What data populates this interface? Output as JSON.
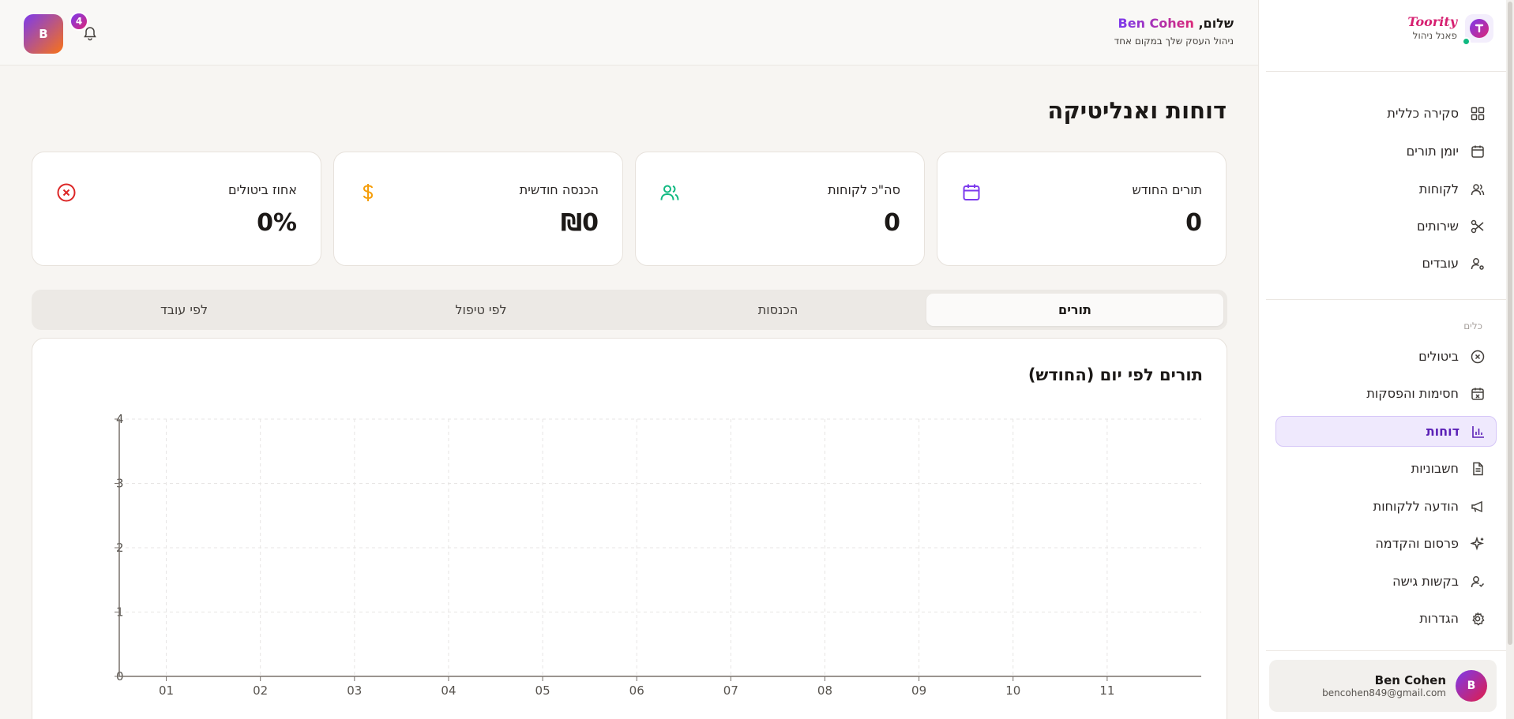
{
  "brand": {
    "name": "Toority",
    "subtitle": "פאנל ניהול"
  },
  "sidebar": {
    "main_items": [
      {
        "label": "סקירה כללית",
        "icon": "dashboard-grid-icon"
      },
      {
        "label": "יומן תורים",
        "icon": "calendar-icon"
      },
      {
        "label": "לקוחות",
        "icon": "users-icon"
      },
      {
        "label": "שירותים",
        "icon": "scissors-icon"
      },
      {
        "label": "עובדים",
        "icon": "user-cog-icon"
      }
    ],
    "tools_label": "כלים",
    "tool_items": [
      {
        "label": "ביטולים",
        "icon": "x-circle-icon"
      },
      {
        "label": "חסימות והפסקות",
        "icon": "calendar-x-icon"
      },
      {
        "label": "דוחות",
        "icon": "bar-chart-icon",
        "active": true
      },
      {
        "label": "חשבוניות",
        "icon": "file-text-icon"
      },
      {
        "label": "הודעה ללקוחות",
        "icon": "megaphone-icon"
      },
      {
        "label": "פרסום והקדמה",
        "icon": "sparkles-icon"
      },
      {
        "label": "בקשות גישה",
        "icon": "user-check-icon"
      },
      {
        "label": "הגדרות",
        "icon": "gear-icon"
      }
    ],
    "user": {
      "initial": "B",
      "name": "Ben Cohen",
      "email": "bencohen849@gmail.com"
    }
  },
  "header": {
    "greeting_prefix": "שלום,",
    "greeting_name": "Ben Cohen",
    "subtitle": "ניהול העסק שלך במקום אחד",
    "avatar_initial": "B",
    "notification_count": "4"
  },
  "page": {
    "title": "דוחות ואנליטיקה"
  },
  "stats": [
    {
      "label": "תורים החודש",
      "value": "0",
      "icon": "calendar-icon",
      "color": "#7c3aed"
    },
    {
      "label": "סה\"כ לקוחות",
      "value": "0",
      "icon": "users-icon",
      "color": "#10b981"
    },
    {
      "label": "הכנסה חודשית",
      "value": "₪0",
      "icon": "dollar-icon",
      "color": "#f59e0b"
    },
    {
      "label": "אחוז ביטולים",
      "value": "0%",
      "icon": "x-circle-icon",
      "color": "#dc2626"
    }
  ],
  "tabs": [
    {
      "label": "תורים",
      "active": true
    },
    {
      "label": "הכנסות"
    },
    {
      "label": "לפי טיפול"
    },
    {
      "label": "לפי עובד"
    }
  ],
  "chart_data": {
    "type": "line",
    "title": "תורים לפי יום (החודש)",
    "x": [
      "01",
      "02",
      "03",
      "04",
      "05",
      "06",
      "07",
      "08",
      "09",
      "10",
      "11"
    ],
    "series": [],
    "yticks": [
      0,
      1,
      2,
      3,
      4
    ],
    "ylim": [
      0,
      4
    ],
    "grid": true
  }
}
